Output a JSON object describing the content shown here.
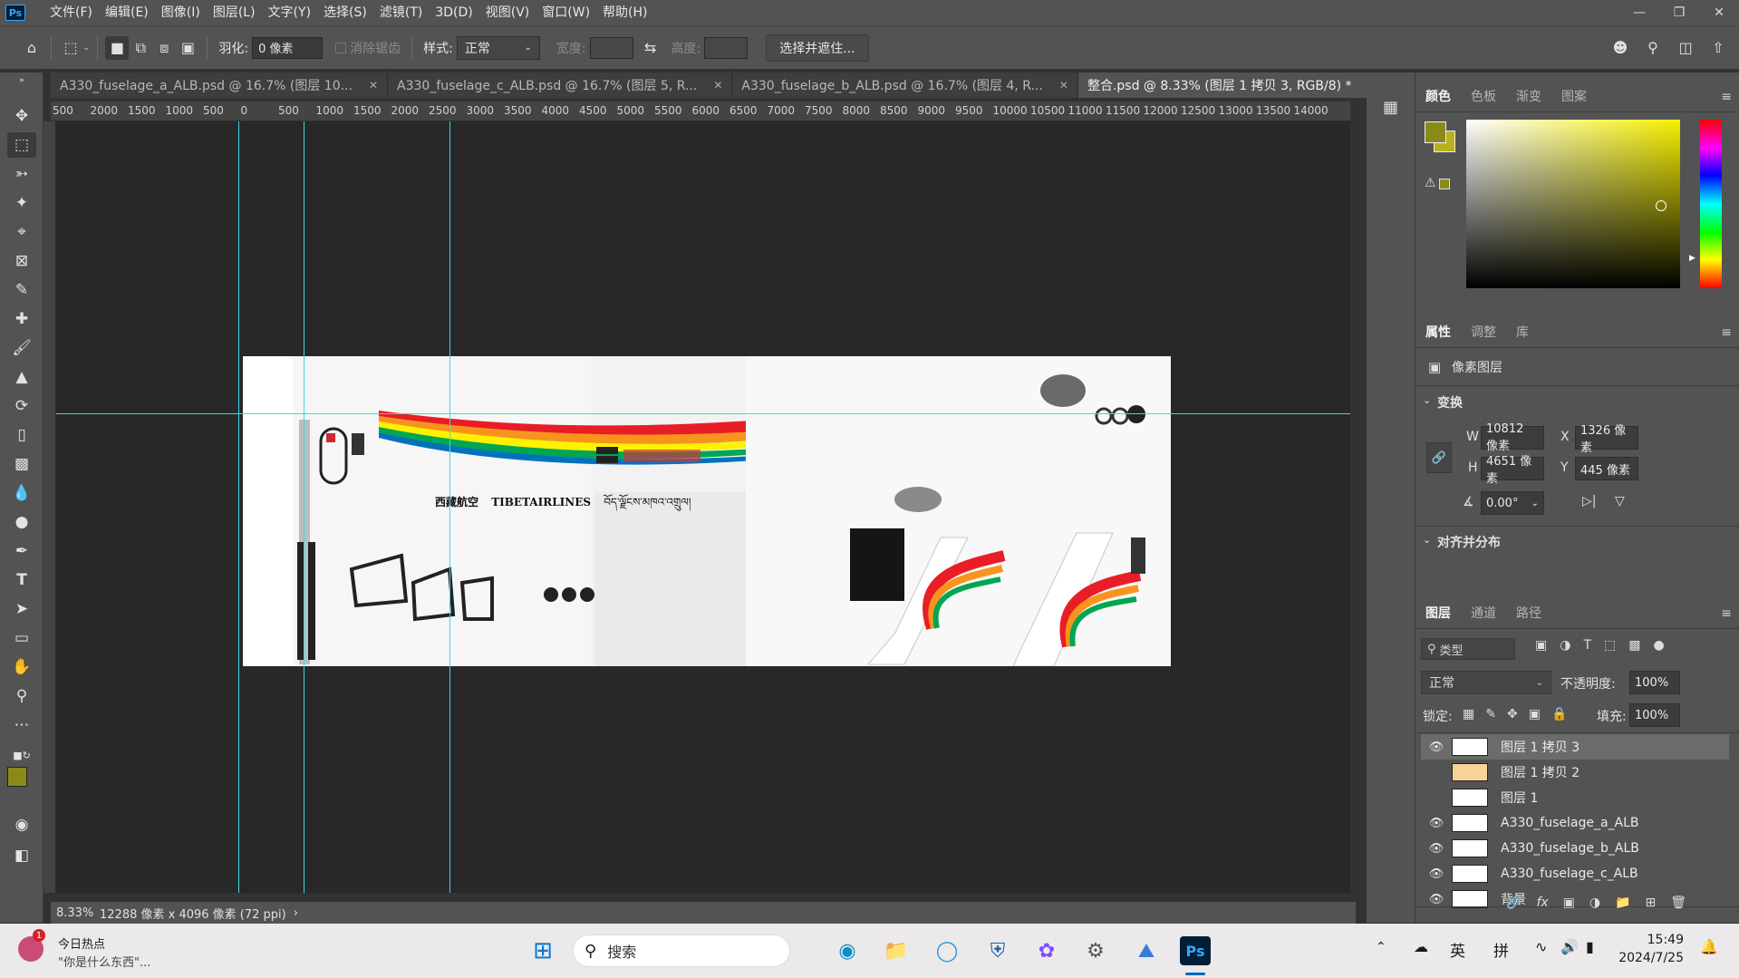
{
  "app": {
    "logo": "Ps"
  },
  "menubar": {
    "items": [
      "文件(F)",
      "编辑(E)",
      "图像(I)",
      "图层(L)",
      "文字(Y)",
      "选择(S)",
      "滤镜(T)",
      "3D(D)",
      "视图(V)",
      "窗口(W)",
      "帮助(H)"
    ]
  },
  "options": {
    "feather_label": "羽化:",
    "feather_value": "0 像素",
    "antialias_label": "消除锯齿",
    "style_label": "样式:",
    "style_value": "正常",
    "width_label": "宽度:",
    "height_label": "高度:",
    "select_mask_label": "选择并遮住..."
  },
  "tabs": [
    {
      "label": "A330_fuselage_a_ALB.psd @ 16.7% (图层 10...",
      "active": false
    },
    {
      "label": "A330_fuselage_c_ALB.psd @ 16.7% (图层 5, R...",
      "active": false
    },
    {
      "label": "A330_fuselage_b_ALB.psd @ 16.7% (图层 4, R...",
      "active": false
    },
    {
      "label": "整合.psd @ 8.33% (图层 1 拷贝 3, RGB/8) *",
      "active": true
    }
  ],
  "ruler": {
    "top_labels": [
      "500",
      "2000",
      "1500",
      "1000",
      "500",
      "0",
      "500",
      "1000",
      "1500",
      "2000",
      "2500",
      "3000",
      "3500",
      "4000",
      "4500",
      "5000",
      "5500",
      "6000",
      "6500",
      "7000",
      "7500",
      "8000",
      "8500",
      "9000",
      "9500",
      "10000",
      "10500",
      "11000",
      "11500",
      "12000",
      "12500",
      "13000",
      "13500",
      "14000"
    ]
  },
  "canvas": {
    "airline_cn": "西藏航空",
    "airline_en": "TIBETAIRLINES",
    "airline_tibetan": "བོད་ལྗོངས་མཁའ་འགྲུལ།"
  },
  "status": {
    "zoom": "8.33%",
    "doc_size": "12288 像素 x 4096 像素 (72 ppi)"
  },
  "color_panel": {
    "tabs": [
      "颜色",
      "色板",
      "渐变",
      "图案"
    ],
    "foreground_color": "#8a8a1a",
    "background_color": "#b9b020"
  },
  "properties_panel": {
    "tabs": [
      "属性",
      "调整",
      "库"
    ],
    "layer_type": "像素图层",
    "transform_label": "变换",
    "w_label": "W",
    "w_value": "10812 像素",
    "x_label": "X",
    "x_value": "1326 像素",
    "h_label": "H",
    "h_value": "4651 像素",
    "y_label": "Y",
    "y_value": "445 像素",
    "angle_value": "0.00°",
    "align_label": "对齐并分布"
  },
  "layers_panel": {
    "tabs": [
      "图层",
      "通道",
      "路径"
    ],
    "filter_label": "类型",
    "blend_mode": "正常",
    "opacity_label": "不透明度:",
    "opacity_value": "100%",
    "lock_label": "锁定:",
    "fill_label": "填充:",
    "fill_value": "100%",
    "layers": [
      {
        "name": "图层 1 拷贝 3",
        "visible": true,
        "selected": true
      },
      {
        "name": "图层 1 拷贝 2",
        "visible": false,
        "selected": false
      },
      {
        "name": "图层 1",
        "visible": false,
        "selected": false
      },
      {
        "name": "A330_fuselage_a_ALB",
        "visible": true,
        "selected": false
      },
      {
        "name": "A330_fuselage_b_ALB",
        "visible": true,
        "selected": false
      },
      {
        "name": "A330_fuselage_c_ALB",
        "visible": true,
        "selected": false
      },
      {
        "name": "背景",
        "visible": true,
        "selected": false
      }
    ]
  },
  "taskbar": {
    "news_badge": "1",
    "news_title": "今日热点",
    "news_subtitle": "\"你是什么东西\"...",
    "search_placeholder": "搜索",
    "ime_lang": "英",
    "ime_mode": "拼",
    "time": "15:49",
    "date": "2024/7/25"
  }
}
